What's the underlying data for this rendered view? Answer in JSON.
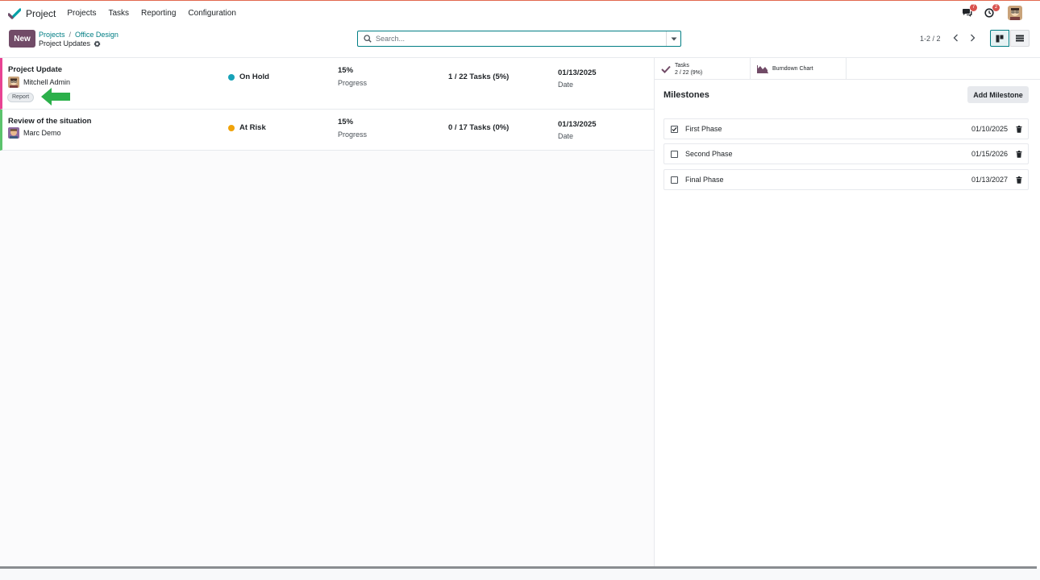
{
  "app": {
    "name": "Project",
    "menu": [
      "Projects",
      "Tasks",
      "Reporting",
      "Configuration"
    ],
    "messages_count": "7",
    "activities_count": "2",
    "colors": {
      "brand": "#714b67",
      "accent": "#017e84"
    }
  },
  "control": {
    "new_label": "New",
    "breadcrumb": [
      "Projects",
      "Office Design"
    ],
    "page_title": "Project Updates",
    "search_placeholder": "Search...",
    "pager": "1-2 / 2"
  },
  "updates": [
    {
      "title": "Project Update",
      "user": "Mitchell Admin",
      "tag": "Report",
      "status": "On Hold",
      "status_color": "#17a2b8",
      "progress": "15%",
      "progress_label": "Progress",
      "tasks": "1 / 22 Tasks (5%)",
      "date": "01/13/2025",
      "date_label": "Date"
    },
    {
      "title": "Review of the situation",
      "user": "Marc Demo",
      "status": "At Risk",
      "status_color": "#f0a30a",
      "progress": "15%",
      "progress_label": "Progress",
      "tasks": "0 / 17 Tasks (0%)",
      "date": "01/13/2025",
      "date_label": "Date"
    }
  ],
  "side": {
    "tasks_tab_title": "Tasks",
    "tasks_tab_value": "2 / 22 (9%)",
    "burndown_label": "Burndown Chart",
    "milestones_title": "Milestones",
    "add_milestone_label": "Add Milestone",
    "milestones": [
      {
        "name": "First Phase",
        "date": "01/10/2025",
        "checked": true
      },
      {
        "name": "Second Phase",
        "date": "01/15/2026",
        "checked": false
      },
      {
        "name": "Final Phase",
        "date": "01/13/2027",
        "checked": false
      }
    ]
  }
}
